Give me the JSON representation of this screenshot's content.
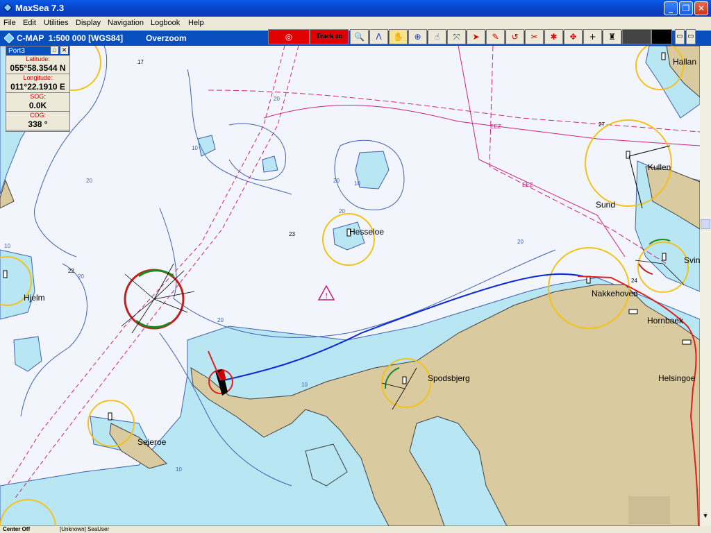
{
  "window": {
    "title": "MaxSea 7.3"
  },
  "menu": [
    "File",
    "Edit",
    "Utilities",
    "Display",
    "Navigation",
    "Logbook",
    "Help"
  ],
  "infobar": {
    "chart": "C-MAP  1:500 000 [WGS84]",
    "zoom": "Overzoom"
  },
  "toolbar": {
    "track_label": "Track on"
  },
  "panel": {
    "title": "Port3",
    "lat_label": "Latitude:",
    "lat": "055°58.3544 N",
    "lon_label": "Longitude:",
    "lon": "011°22.1910 E",
    "sog_label": "SOG:",
    "sog": "0.0K",
    "cog_label": "COG:",
    "cog": "338 °"
  },
  "places": {
    "hallan": "Hallan",
    "kullen": "Kullen",
    "sund": "Sund",
    "hesseloe": "Hesseloe",
    "hjelm": "Hjelm",
    "svin": "Svin",
    "nakkehoved": "Nakkehoved",
    "hornbaek": "Hornbaek",
    "spodsbjerg": "Spodsbjerg",
    "helsingoe": "Helsingoe",
    "sejeroe": "Sejeroe"
  },
  "depths": {
    "d17": "17",
    "d27": "27",
    "d23": "23",
    "d22": "22",
    "d24": "24"
  },
  "contours": {
    "c20": "20",
    "c10": "10"
  },
  "zones": {
    "eez": "EEZ"
  },
  "status": {
    "left": "Center Off",
    "user": "[Unknown] SeaUser"
  },
  "colors": {
    "land": "#d9caa0",
    "shallow": "#b8e6f3",
    "deep": "#f2f5fb",
    "track": "#0a2ad8",
    "route": "#e02020",
    "light_range": "#f2c21a"
  }
}
